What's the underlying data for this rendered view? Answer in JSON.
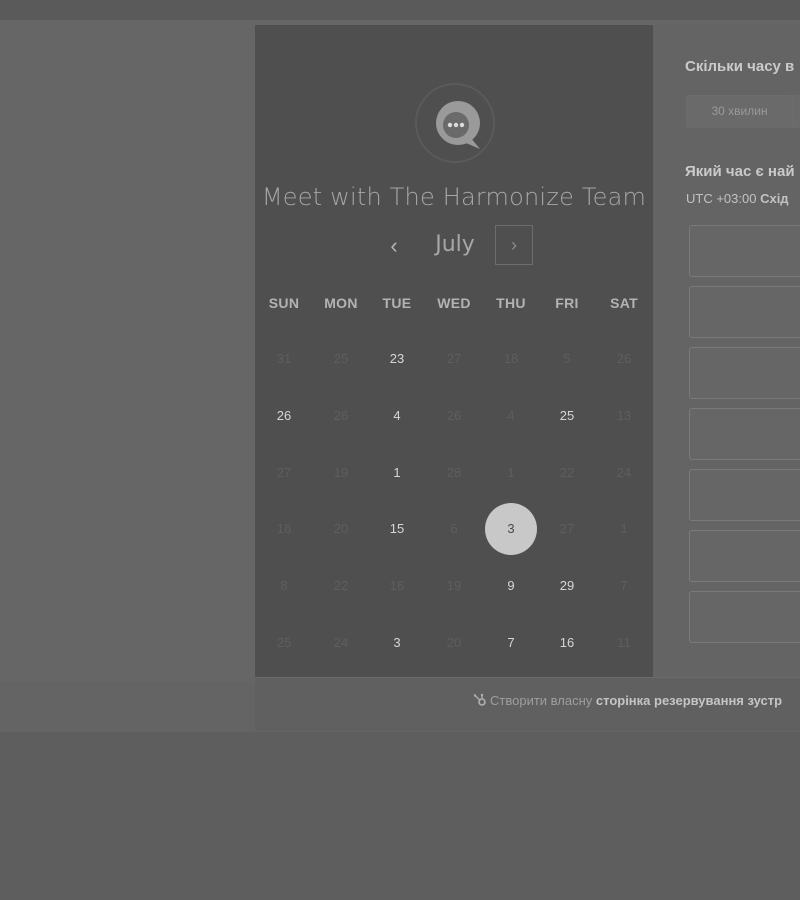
{
  "scheduler": {
    "title": "Meet with The Harmonize Team",
    "month": "July",
    "prev_symbol": "‹",
    "next_symbol": "›",
    "weekdays": [
      "SUN",
      "MON",
      "TUE",
      "WED",
      "THU",
      "FRI",
      "SAT"
    ],
    "weeks": [
      [
        {
          "d": "31",
          "on": false
        },
        {
          "d": "25",
          "on": false
        },
        {
          "d": "23",
          "on": true
        },
        {
          "d": "27",
          "on": false
        },
        {
          "d": "18",
          "on": false
        },
        {
          "d": "5",
          "on": false
        },
        {
          "d": "26",
          "on": false
        }
      ],
      [
        {
          "d": "26",
          "on": true
        },
        {
          "d": "26",
          "on": false
        },
        {
          "d": "4",
          "on": true
        },
        {
          "d": "26",
          "on": false
        },
        {
          "d": "4",
          "on": false
        },
        {
          "d": "25",
          "on": true
        },
        {
          "d": "13",
          "on": false
        }
      ],
      [
        {
          "d": "27",
          "on": false
        },
        {
          "d": "19",
          "on": false
        },
        {
          "d": "1",
          "on": true
        },
        {
          "d": "28",
          "on": false
        },
        {
          "d": "1",
          "on": false
        },
        {
          "d": "22",
          "on": false
        },
        {
          "d": "24",
          "on": false
        }
      ],
      [
        {
          "d": "16",
          "on": false
        },
        {
          "d": "20",
          "on": false
        },
        {
          "d": "15",
          "on": true
        },
        {
          "d": "6",
          "on": false
        },
        {
          "d": "3",
          "on": true,
          "selected": true
        },
        {
          "d": "27",
          "on": false
        },
        {
          "d": "1",
          "on": false
        }
      ],
      [
        {
          "d": "8",
          "on": false
        },
        {
          "d": "22",
          "on": false
        },
        {
          "d": "16",
          "on": false
        },
        {
          "d": "19",
          "on": false
        },
        {
          "d": "9",
          "on": true
        },
        {
          "d": "29",
          "on": true
        },
        {
          "d": "7",
          "on": false
        }
      ],
      [
        {
          "d": "25",
          "on": false
        },
        {
          "d": "24",
          "on": false
        },
        {
          "d": "3",
          "on": true
        },
        {
          "d": "20",
          "on": false
        },
        {
          "d": "7",
          "on": true
        },
        {
          "d": "16",
          "on": true
        },
        {
          "d": "11",
          "on": false
        }
      ]
    ]
  },
  "booking": {
    "duration_question": "Скільки часу в",
    "duration_option": "30 хвилин",
    "time_question": "Який час є най",
    "timezone_offset": "UTC +03:00",
    "timezone_name": "Схід",
    "slot_count": 7
  },
  "footer": {
    "prefix": "Створити власну",
    "bold": "сторінка резервування зустр"
  },
  "colors": {
    "panel": "#4f4f4f",
    "selected_day": "#c8c8c8",
    "logo_bubble": "#9a9a9a"
  },
  "icons": {
    "logo": "chat-bubble-logo",
    "footer": "hubspot-sprocket-icon"
  }
}
